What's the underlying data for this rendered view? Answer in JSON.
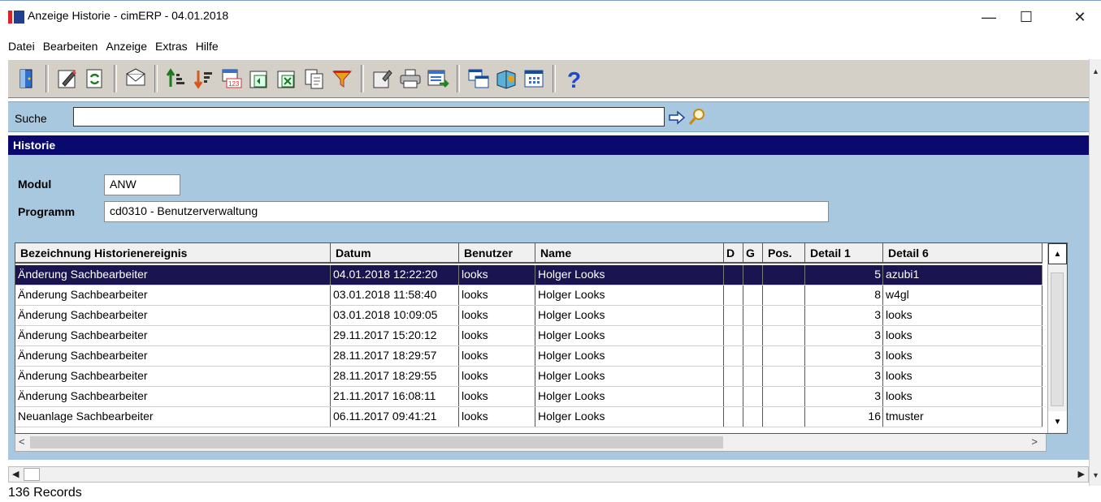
{
  "window": {
    "title": "Anzeige Historie - cimERP - 04.01.2018",
    "minimize": "—",
    "maximize": "☐",
    "close": "✕"
  },
  "menu": [
    "Datei",
    "Bearbeiten",
    "Anzeige",
    "Extras",
    "Hilfe"
  ],
  "search": {
    "label": "Suche",
    "value": "",
    "placeholder": ""
  },
  "section": {
    "title": "Historie"
  },
  "form": {
    "modul_label": "Modul",
    "modul_value": "ANW",
    "programm_label": "Programm",
    "programm_value": "cd0310 - Benutzerverwaltung"
  },
  "grid": {
    "columns": [
      "Bezeichnung Historienereignis",
      "Datum",
      "Benutzer",
      "Name",
      "D",
      "G",
      "Pos.",
      "Detail 1",
      "Detail 6"
    ],
    "rows": [
      {
        "bezeichnung": "Änderung Sachbearbeiter",
        "datum": "04.01.2018 12:22:20",
        "benutzer": "looks",
        "name": "Holger Looks",
        "d": "",
        "g": "",
        "pos": "",
        "detail1": "5",
        "detail6": "azubi1"
      },
      {
        "bezeichnung": "Änderung Sachbearbeiter",
        "datum": "03.01.2018 11:58:40",
        "benutzer": "looks",
        "name": "Holger Looks",
        "d": "",
        "g": "",
        "pos": "",
        "detail1": "8",
        "detail6": "w4gl"
      },
      {
        "bezeichnung": "Änderung Sachbearbeiter",
        "datum": "03.01.2018 10:09:05",
        "benutzer": "looks",
        "name": "Holger Looks",
        "d": "",
        "g": "",
        "pos": "",
        "detail1": "3",
        "detail6": "looks"
      },
      {
        "bezeichnung": "Änderung Sachbearbeiter",
        "datum": "29.11.2017 15:20:12",
        "benutzer": "looks",
        "name": "Holger Looks",
        "d": "",
        "g": "",
        "pos": "",
        "detail1": "3",
        "detail6": "looks"
      },
      {
        "bezeichnung": "Änderung Sachbearbeiter",
        "datum": "28.11.2017 18:29:57",
        "benutzer": "looks",
        "name": "Holger Looks",
        "d": "",
        "g": "",
        "pos": "",
        "detail1": "3",
        "detail6": "looks"
      },
      {
        "bezeichnung": "Änderung Sachbearbeiter",
        "datum": "28.11.2017 18:29:55",
        "benutzer": "looks",
        "name": "Holger Looks",
        "d": "",
        "g": "",
        "pos": "",
        "detail1": "3",
        "detail6": "looks"
      },
      {
        "bezeichnung": "Änderung Sachbearbeiter",
        "datum": "21.11.2017 16:08:11",
        "benutzer": "looks",
        "name": "Holger Looks",
        "d": "",
        "g": "",
        "pos": "",
        "detail1": "3",
        "detail6": "looks"
      },
      {
        "bezeichnung": "Neuanlage Sachbearbeiter",
        "datum": "06.11.2017 09:41:21",
        "benutzer": "looks",
        "name": "Holger Looks",
        "d": "",
        "g": "",
        "pos": "",
        "detail1": "16",
        "detail6": "tmuster"
      }
    ],
    "selected_row": 0
  },
  "toolbar_icons": [
    "exit-door-icon",
    "edit-pencil-icon",
    "refresh-icon",
    "mail-icon",
    "sort-ascending-icon",
    "sort-descending-icon",
    "calendar-123-icon",
    "export-icon",
    "excel-export-icon",
    "copy-document-icon",
    "filter-funnel-icon",
    "properties-icon",
    "print-icon",
    "list-transfer-icon",
    "windows-icon",
    "book-icon",
    "grid-view-icon",
    "help-icon"
  ],
  "status": {
    "records": "136 Records"
  },
  "colors": {
    "section_header_bg": "#0a0a6e",
    "panel_bg": "#a7c8de",
    "selected_row_bg": "#1a1450",
    "toolbar_bg": "#d4d0c8"
  }
}
